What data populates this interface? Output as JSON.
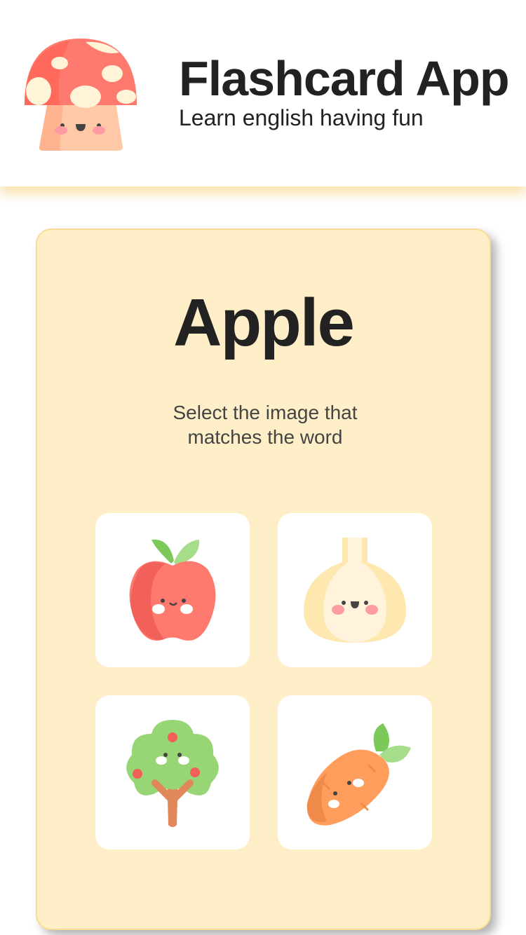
{
  "header": {
    "title": "Flashcard App",
    "subtitle": "Learn english having fun",
    "logo_icon": "mushroom-icon"
  },
  "card": {
    "word": "Apple",
    "instruction": "Select the image that matches the word",
    "options": [
      {
        "icon": "apple-icon"
      },
      {
        "icon": "garlic-icon"
      },
      {
        "icon": "tree-icon"
      },
      {
        "icon": "carrot-icon"
      }
    ]
  },
  "colors": {
    "card_bg": "#feefc8",
    "card_border": "#f8dc91",
    "header_shadow": "#f6d68c"
  }
}
